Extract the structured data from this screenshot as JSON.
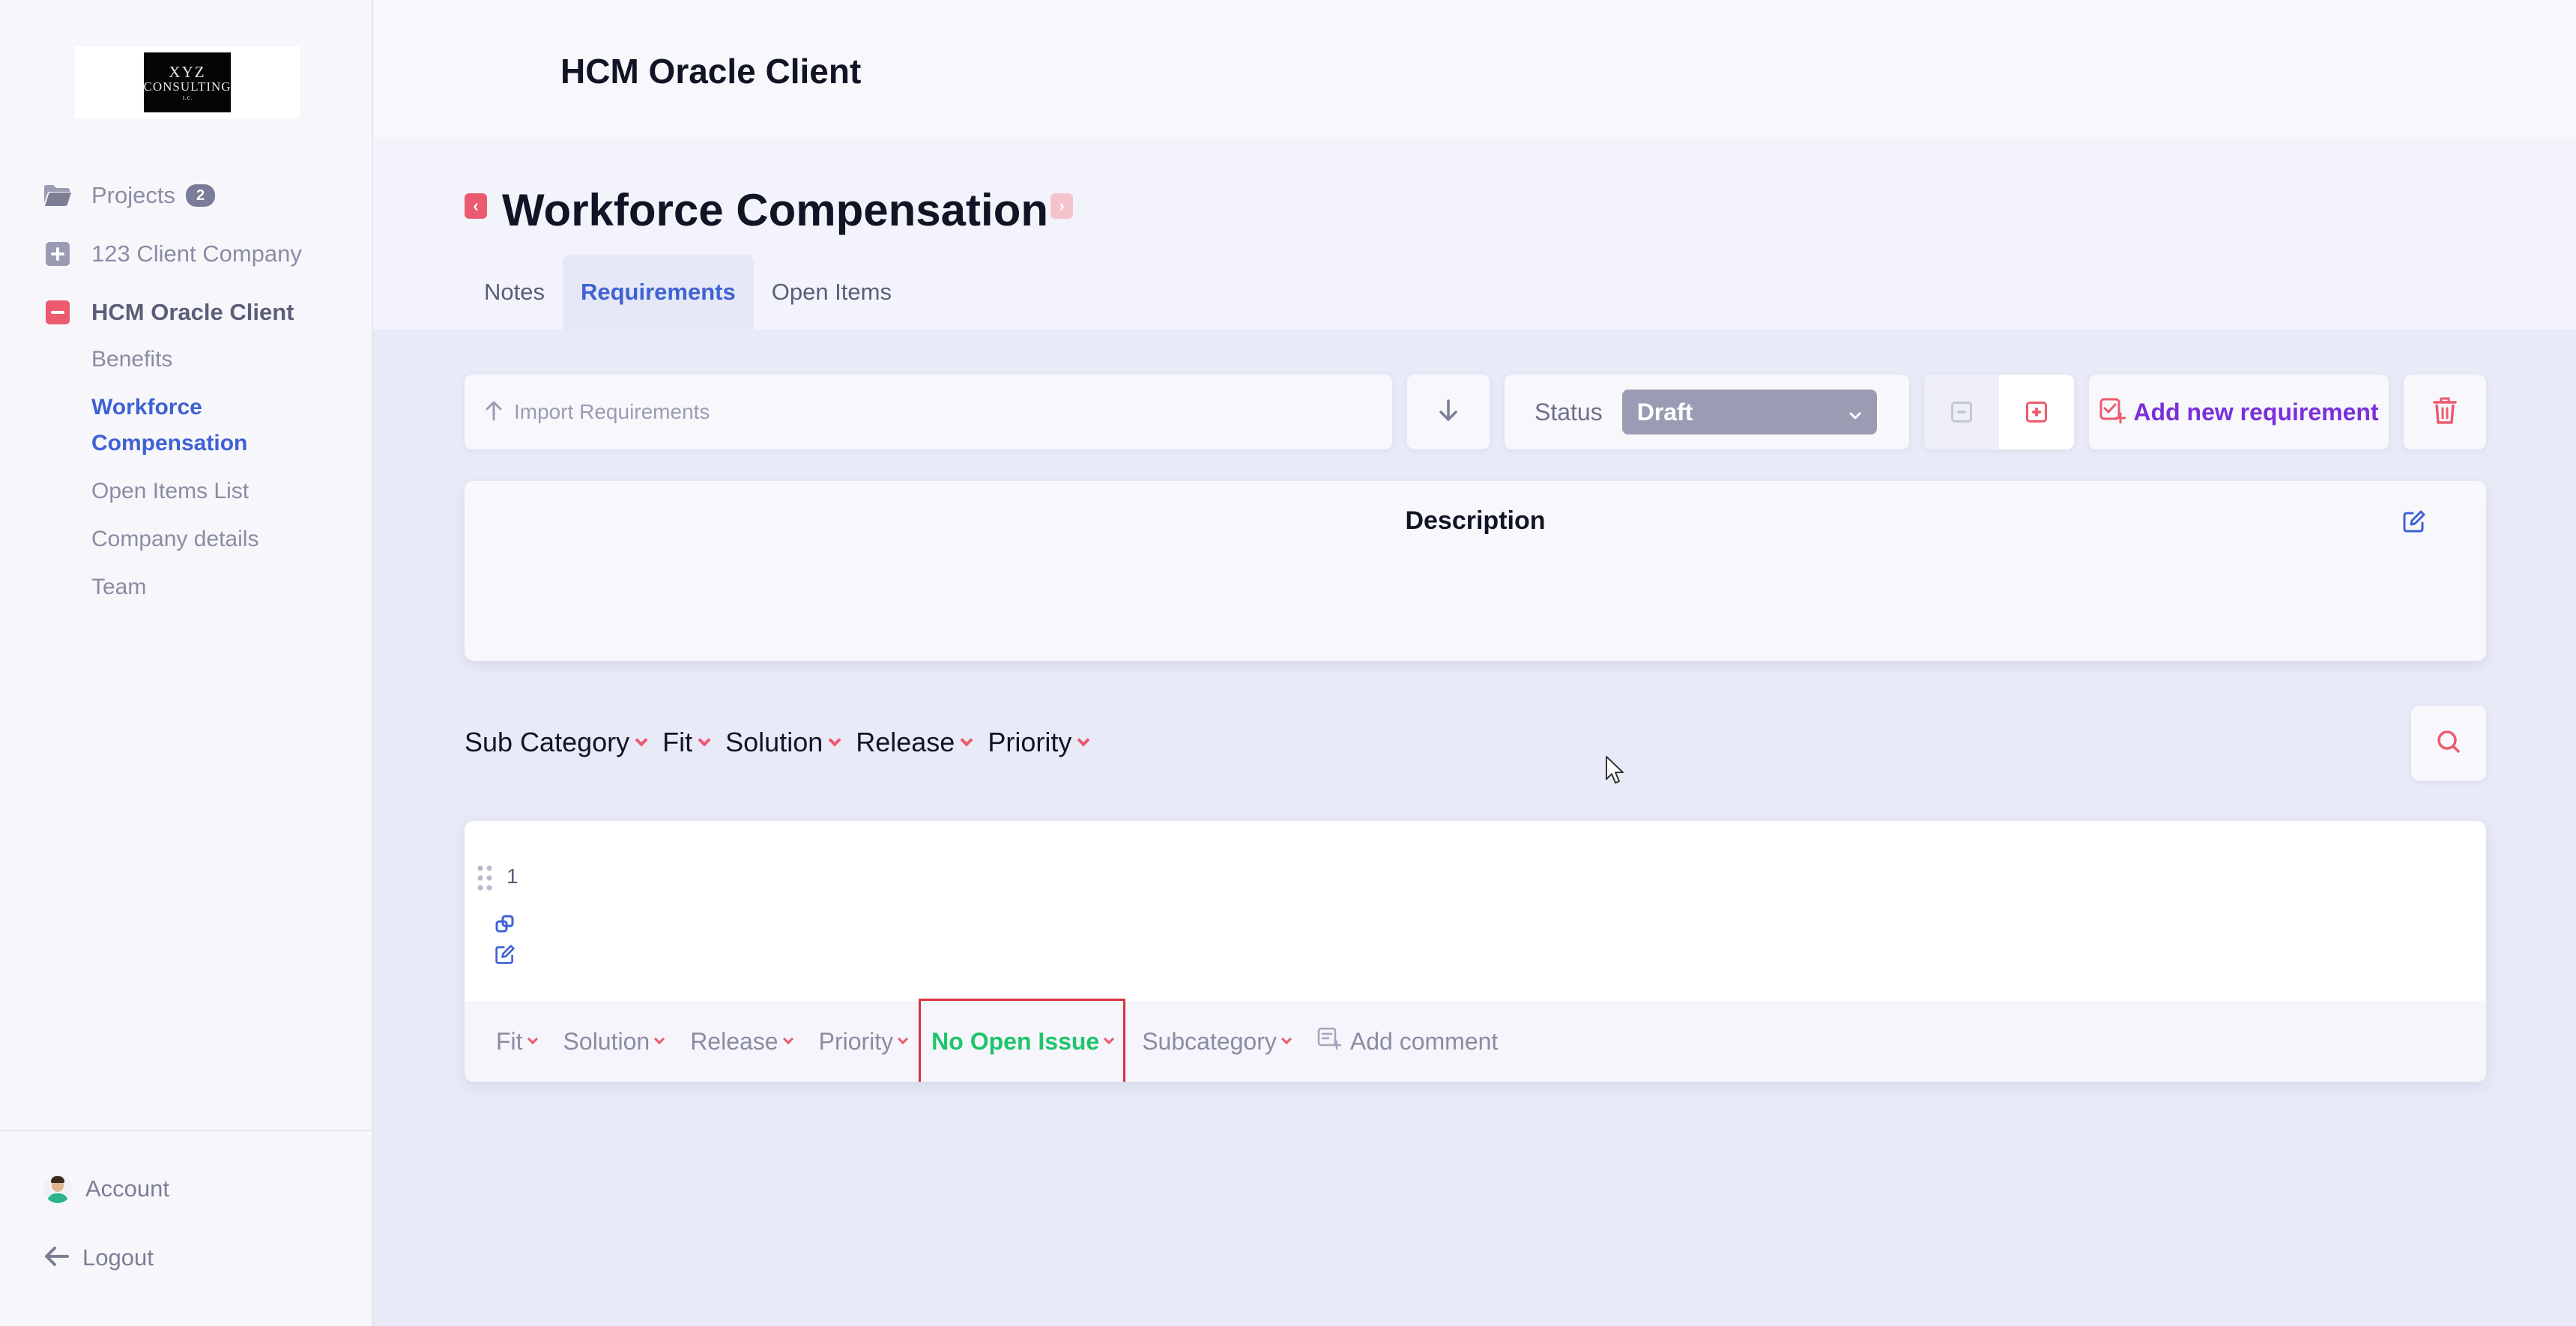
{
  "sidebar": {
    "logo": {
      "line1": "XYZ",
      "line2": "CONSULTING",
      "line3": "L.C."
    },
    "nav": [
      {
        "label": "Projects",
        "badge": "2",
        "icon": "folder-icon"
      },
      {
        "label": "123 Client Company",
        "icon": "plus-square-icon"
      },
      {
        "label": "HCM Oracle Client",
        "icon": "minus-square-icon"
      }
    ],
    "subnav": [
      "Benefits",
      "Workforce Compensation",
      "Open Items List",
      "Company details",
      "Team"
    ],
    "account_label": "Account",
    "logout_label": "Logout"
  },
  "header": {
    "app_title": "HCM Oracle Client"
  },
  "page": {
    "title": "Workforce Compensation",
    "tabs": [
      "Notes",
      "Requirements",
      "Open Items"
    ],
    "active_tab": "Requirements"
  },
  "toolbar": {
    "import_label": "Import Requirements",
    "status_label": "Status",
    "status_value": "Draft",
    "add_label": "Add new requirement"
  },
  "description": {
    "title": "Description"
  },
  "filters": [
    "Sub Category",
    "Fit",
    "Solution",
    "Release",
    "Priority"
  ],
  "requirement": {
    "number": "1",
    "footer": {
      "fit": "Fit",
      "solution": "Solution",
      "release": "Release",
      "priority": "Priority",
      "open_issue": "No Open Issue",
      "subcategory": "Subcategory",
      "comment": "Add comment"
    }
  },
  "colors": {
    "accent_blue": "#3f61d4",
    "accent_red": "#ec5a6f",
    "accent_purple": "#7b2fd9",
    "success_green": "#1ec56b",
    "status_grey": "#9a9cb3"
  }
}
